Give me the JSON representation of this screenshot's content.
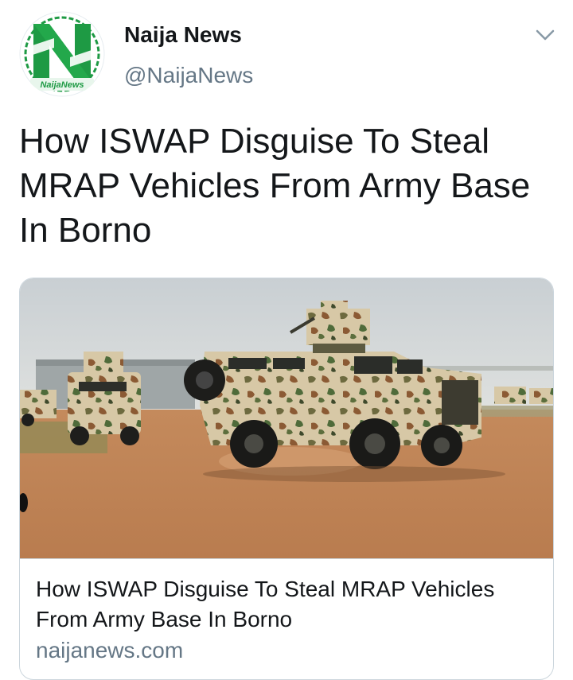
{
  "account": {
    "display_name": "Naija News",
    "handle": "@NaijaNews",
    "avatar_icon": "naija-news-logo",
    "avatar_logo_text": "NaijaNews",
    "brand_color": "#1e9a44"
  },
  "menu": {
    "icon": "chevron-down-icon"
  },
  "tweet": {
    "text": "How ISWAP Disguise To Steal\nMRAP Vehicles From Army Base\nIn Borno"
  },
  "card": {
    "image_subject": "camouflaged MRAP armored vehicles on dirt field",
    "title": "How ISWAP Disguise To Steal MRAP Vehicles From Army Base In Borno",
    "domain": "naijanews.com"
  },
  "colors": {
    "text_primary": "#14171a",
    "text_secondary": "#657786",
    "border": "#ccd6dd"
  }
}
